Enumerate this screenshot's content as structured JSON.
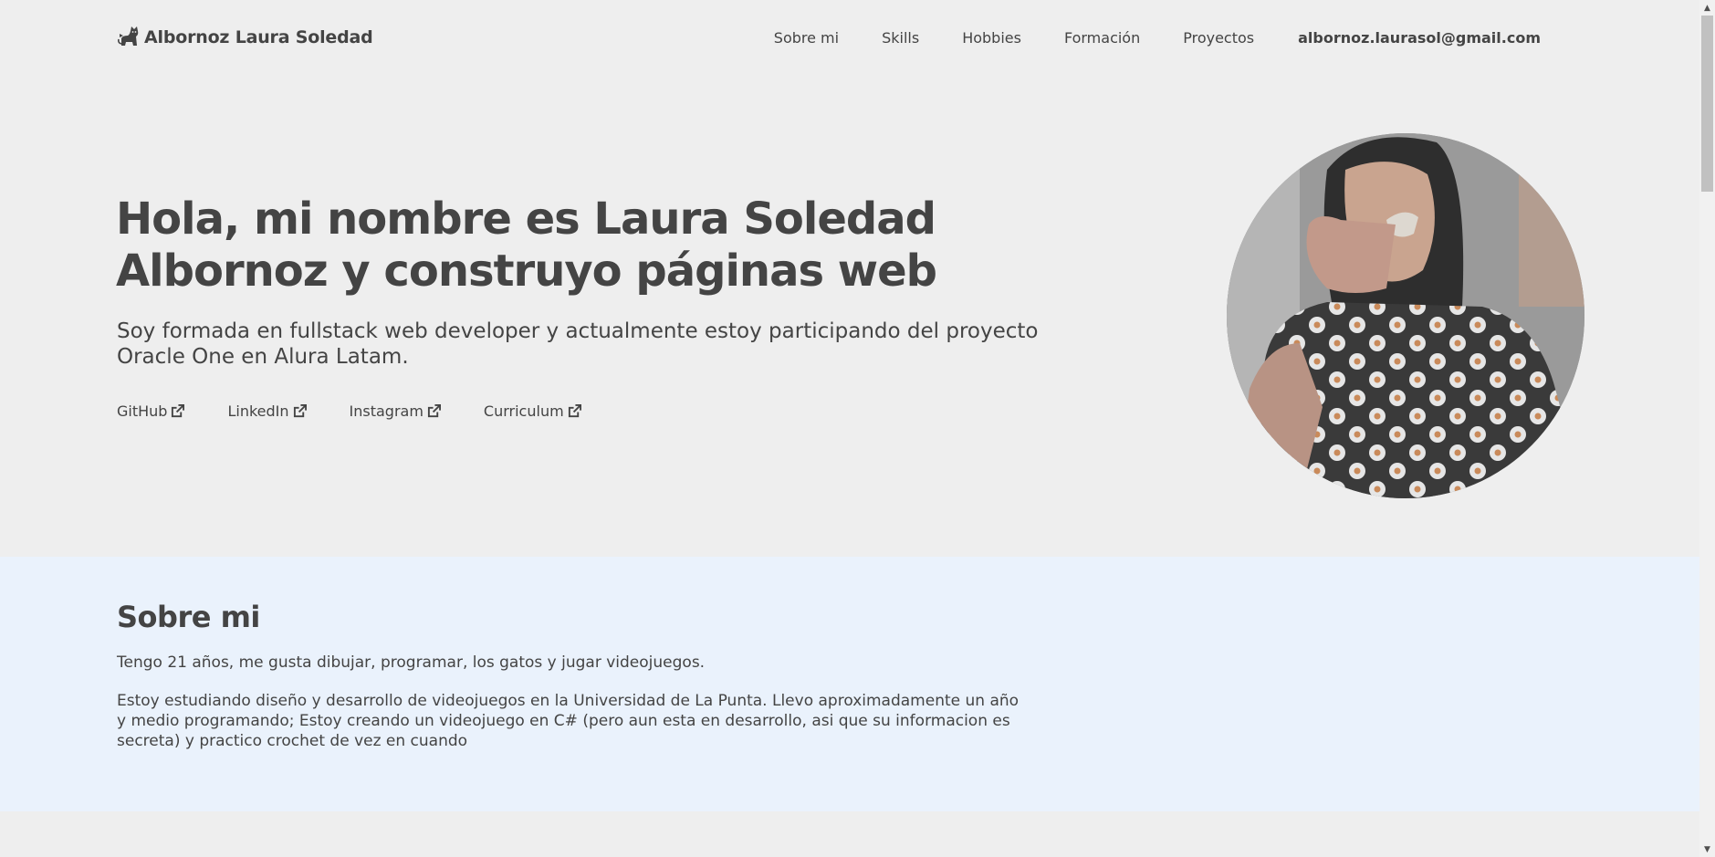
{
  "header": {
    "brand": "Albornoz Laura Soledad",
    "brand_icon": "cat-icon",
    "nav": [
      "Sobre mi",
      "Skills",
      "Hobbies",
      "Formación",
      "Proyectos"
    ],
    "email": "albornoz.laurasol@gmail.com"
  },
  "hero": {
    "title": "Hola, mi nombre es Laura Soledad Albornoz y construyo páginas web",
    "subtitle": "Soy formada en fullstack web developer y actualmente estoy participando del proyecto Oracle One en Alura Latam.",
    "links": [
      "GitHub",
      "LinkedIn",
      "Instagram",
      "Curriculum"
    ],
    "link_icon": "external-link-icon"
  },
  "about": {
    "title": "Sobre mi",
    "p1": "Tengo 21 años, me gusta dibujar, programar, los gatos y jugar videojuegos.",
    "p2": "Estoy estudiando diseño y desarrollo de videojuegos en la Universidad de La Punta. Llevo aproximadamente un año y medio programando; Estoy creando un videojuego en C# (pero aun esta en desarrollo, asi que su informacion es secreta) y practico crochet de vez en cuando"
  },
  "colors": {
    "page_bg": "#eeeeee",
    "text": "#444444",
    "about_bg": "#eaf2fc"
  }
}
